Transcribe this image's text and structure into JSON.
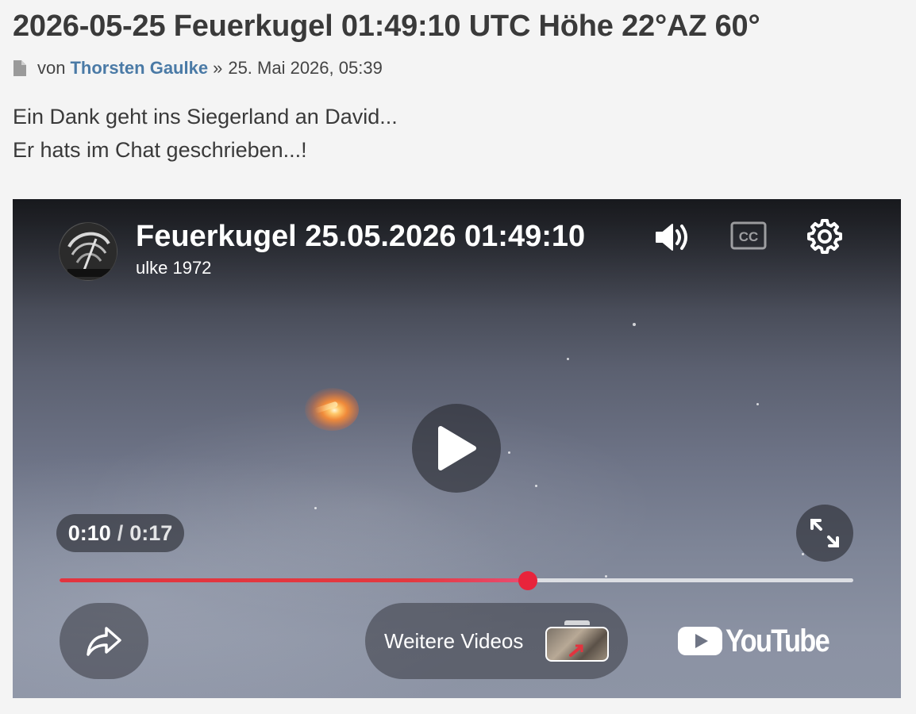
{
  "post": {
    "title": "2026-05-25 Feuerkugel 01:49:10 UTC Höhe 22°AZ 60°",
    "meta": {
      "icon": "document-icon",
      "prefix": "von",
      "author": "Thorsten Gaulke",
      "separator": "»",
      "date": "25. Mai 2026, 05:39"
    },
    "body": [
      "Ein Dank geht ins Siegerland an David...",
      "Er hats im Chat geschrieben...!"
    ]
  },
  "player": {
    "video_title": "Feuerkugel 25.05.2026 01:49:10",
    "channel": "ulke 1972",
    "icons": {
      "volume": "volume-icon",
      "captions": "cc-icon",
      "settings": "gear-icon",
      "play": "play-icon",
      "fullscreen": "fullscreen-icon",
      "share": "share-icon"
    },
    "captions_label": "CC",
    "time": {
      "current": "0:10",
      "separator": "/",
      "total": "0:17"
    },
    "progress_fraction": 0.59,
    "more_videos_label": "Weitere Videos",
    "youtube_wordmark": "YouTube",
    "colors": {
      "progress": "#e3393f",
      "youtube_red": "#ffffff",
      "overlay": "rgba(40,42,48,0.62)"
    }
  }
}
